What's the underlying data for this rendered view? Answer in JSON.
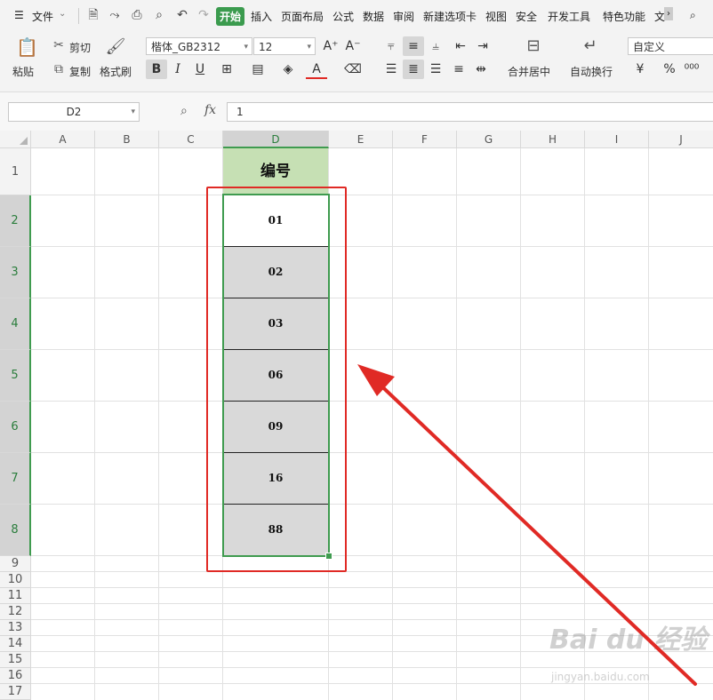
{
  "menubar": {
    "file_label": "文件",
    "tabs": [
      {
        "label": "开始",
        "active": true
      },
      {
        "label": "插入"
      },
      {
        "label": "页面布局"
      },
      {
        "label": "公式"
      },
      {
        "label": "数据"
      },
      {
        "label": "审阅"
      },
      {
        "label": "新建选项卡"
      },
      {
        "label": "视图"
      },
      {
        "label": "安全"
      },
      {
        "label": "开发工具"
      },
      {
        "label": "特色功能"
      },
      {
        "label": "文"
      }
    ],
    "search_icon": "search-icon"
  },
  "ribbon": {
    "paste_label": "粘贴",
    "cut_label": "剪切",
    "copy_label": "复制",
    "format_painter_label": "格式刷",
    "font_name": "楷体_GB2312",
    "font_size": "12",
    "bold": "B",
    "italic": "I",
    "underline": "U",
    "font_color_letter": "A",
    "merge_label": "合并居中",
    "wrap_label": "自动换行",
    "number_format": "自定义",
    "percent": "%"
  },
  "formula_bar": {
    "name_box": "D2",
    "fx_label": "fx",
    "value": "1"
  },
  "sheet": {
    "columns": [
      "A",
      "B",
      "C",
      "D",
      "E",
      "F",
      "G",
      "H",
      "I",
      "J"
    ],
    "selected_column": "D",
    "rows": [
      "1",
      "2",
      "3",
      "4",
      "5",
      "6",
      "7",
      "8",
      "9",
      "10",
      "11",
      "12",
      "13",
      "14",
      "15",
      "16",
      "17"
    ],
    "selected_rows": [
      "2",
      "3",
      "4",
      "5",
      "6",
      "7",
      "8"
    ],
    "header_cell": "编号",
    "values": [
      "01",
      "02",
      "03",
      "06",
      "09",
      "16",
      "88"
    ],
    "colors": {
      "header_fill": "#c6e0b4",
      "data_fill": "#d9d9d9",
      "selection": "#3f9b4f",
      "annotation": "#e02a25"
    }
  },
  "watermark": {
    "brand": "Bai du 经验",
    "url": "jingyan.baidu.com"
  }
}
